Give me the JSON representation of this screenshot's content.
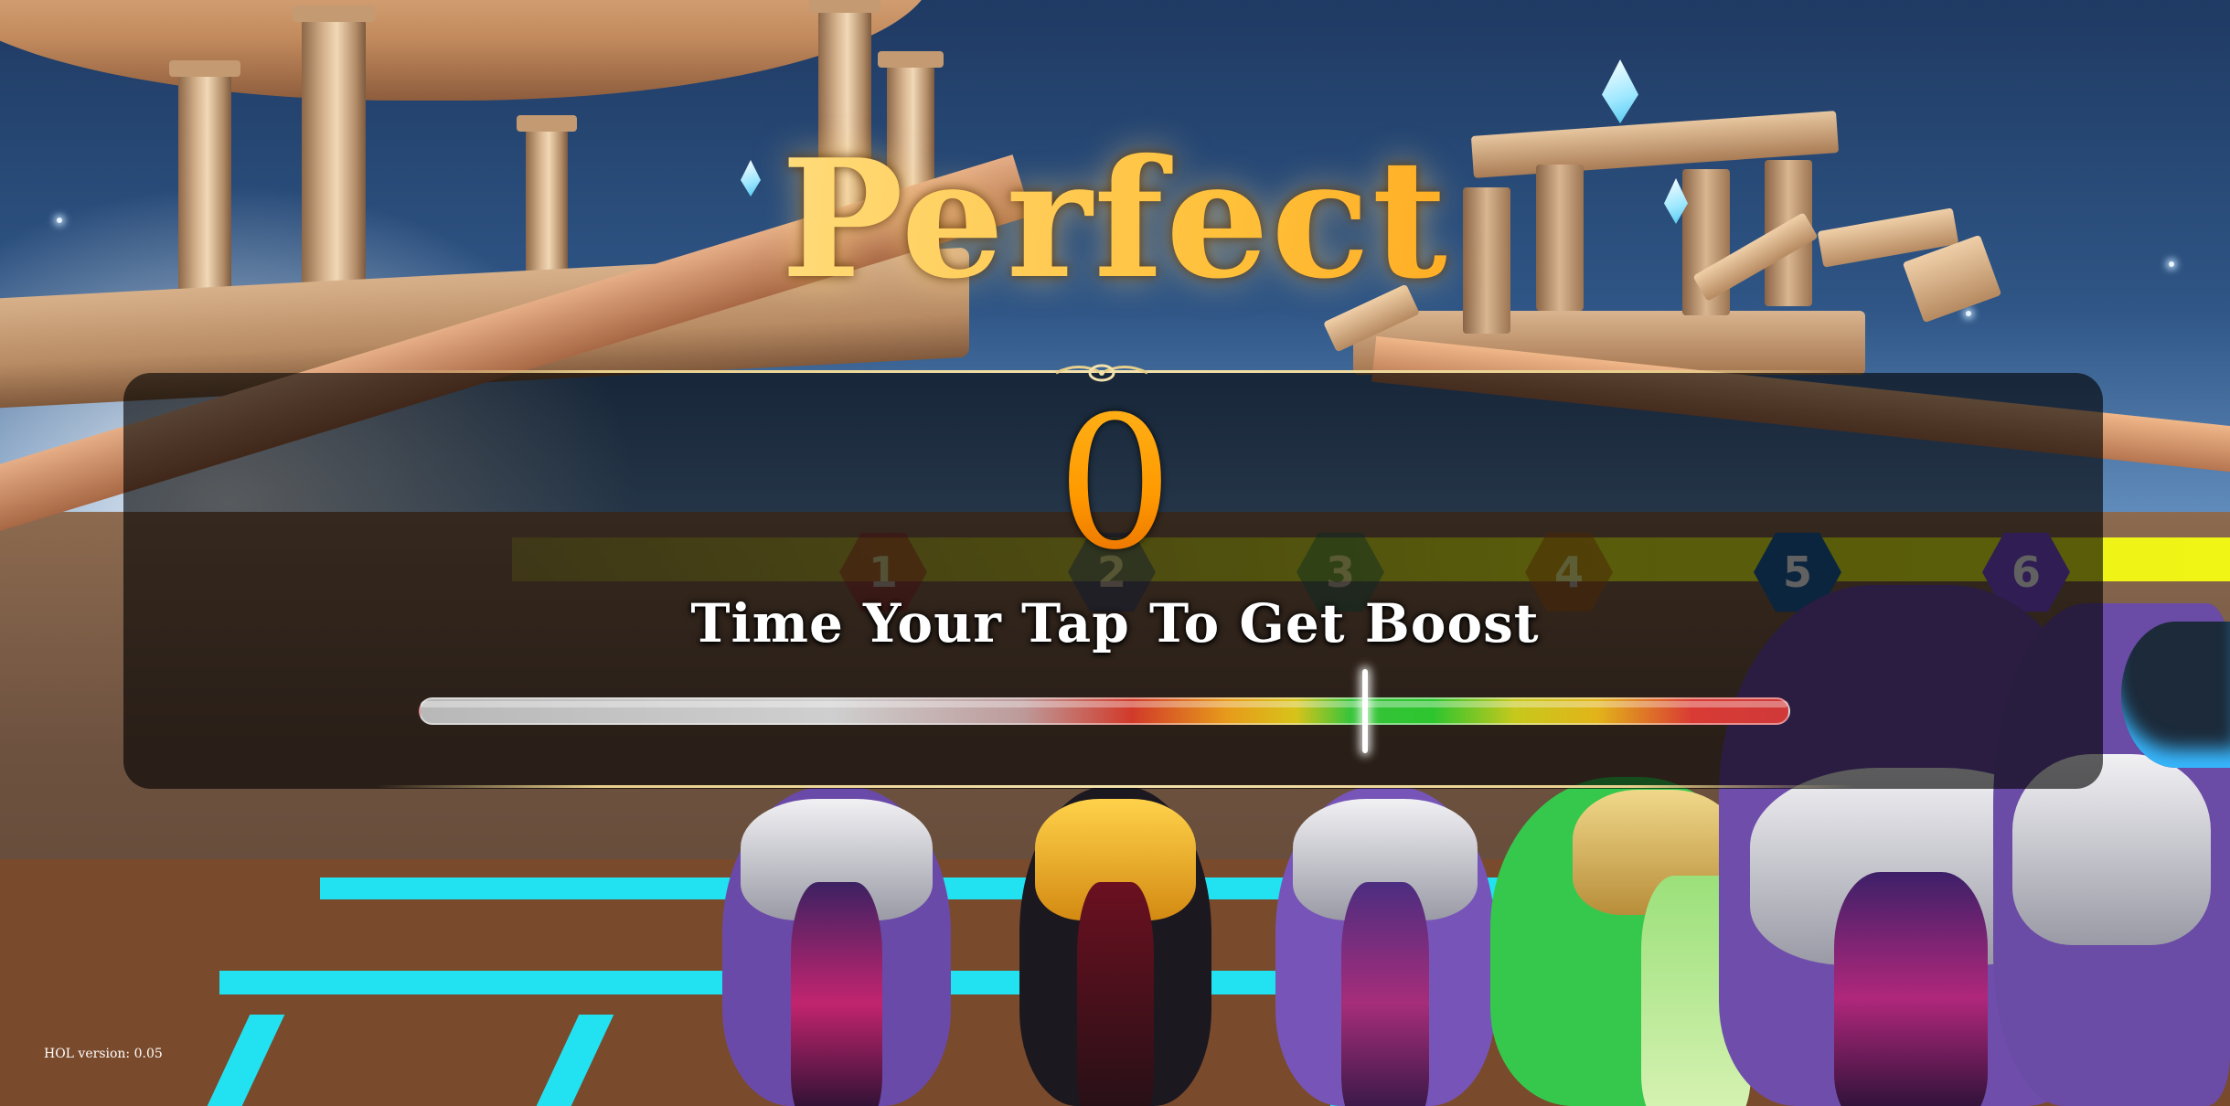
{
  "hud": {
    "rating_text": "Perfect",
    "counter_value": "0",
    "instruction_text": "Time Your Tap To Get Boost",
    "boost_meter": {
      "marker_position_fraction": 0.69
    },
    "version_text": "HOL version: 0.05"
  },
  "gates": [
    {
      "number": "1",
      "color": "#b0202c"
    },
    {
      "number": "2",
      "color": "#1f3f88"
    },
    {
      "number": "3",
      "color": "#17705a"
    },
    {
      "number": "4",
      "color": "#c0620f"
    },
    {
      "number": "5",
      "color": "#1f63a6"
    },
    {
      "number": "6",
      "color": "#7b4ed9"
    }
  ],
  "colors": {
    "rating_gold": "#ffc03a",
    "counter_orange": "#ff9a00",
    "panel": "#000000",
    "lane_cyan": "#22e2f2",
    "gate_strip_yellow": "#e7f01e"
  }
}
